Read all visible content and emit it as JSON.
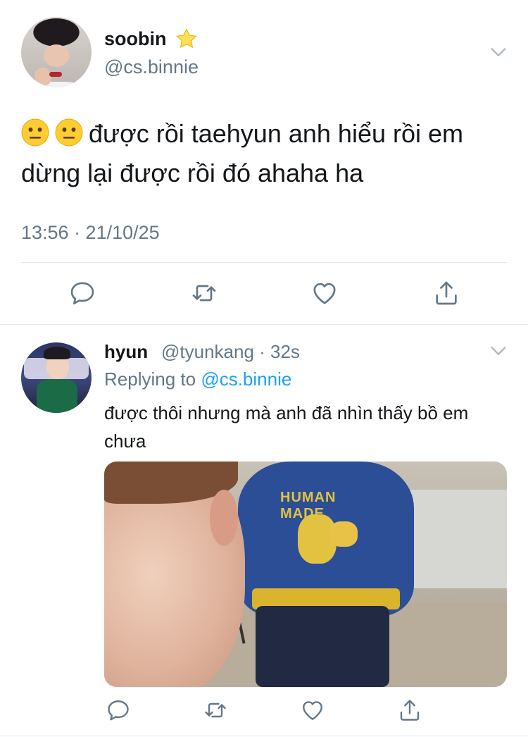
{
  "main_tweet": {
    "name": "soobin",
    "name_badge_icon": "star-icon",
    "handle": "@cs.binnie",
    "emojis": [
      "neutral-face-emoji",
      "neutral-face-emoji"
    ],
    "text": "được rồi taehyun anh hiểu rồi em dừng lại được rồi đó ahaha ha",
    "timestamp": "13:56 · 21/10/25",
    "actions": [
      "reply-icon",
      "retweet-icon",
      "like-icon",
      "share-icon"
    ]
  },
  "reply_tweet": {
    "name": "hyun",
    "handle_time": "@tyunkang · 32s",
    "replying_prefix": "Replying to ",
    "replying_to": "@cs.binnie",
    "text": "được thôi nhưng mà anh đã nhìn thấy bồ em chưa",
    "media_logo_text": "HUMAN MADE",
    "actions": [
      "reply-icon",
      "retweet-icon",
      "like-icon",
      "share-icon"
    ]
  },
  "colors": {
    "text": "#14171a",
    "secondary": "#657786",
    "link": "#1da1f2",
    "divider": "#e1e8ed"
  }
}
